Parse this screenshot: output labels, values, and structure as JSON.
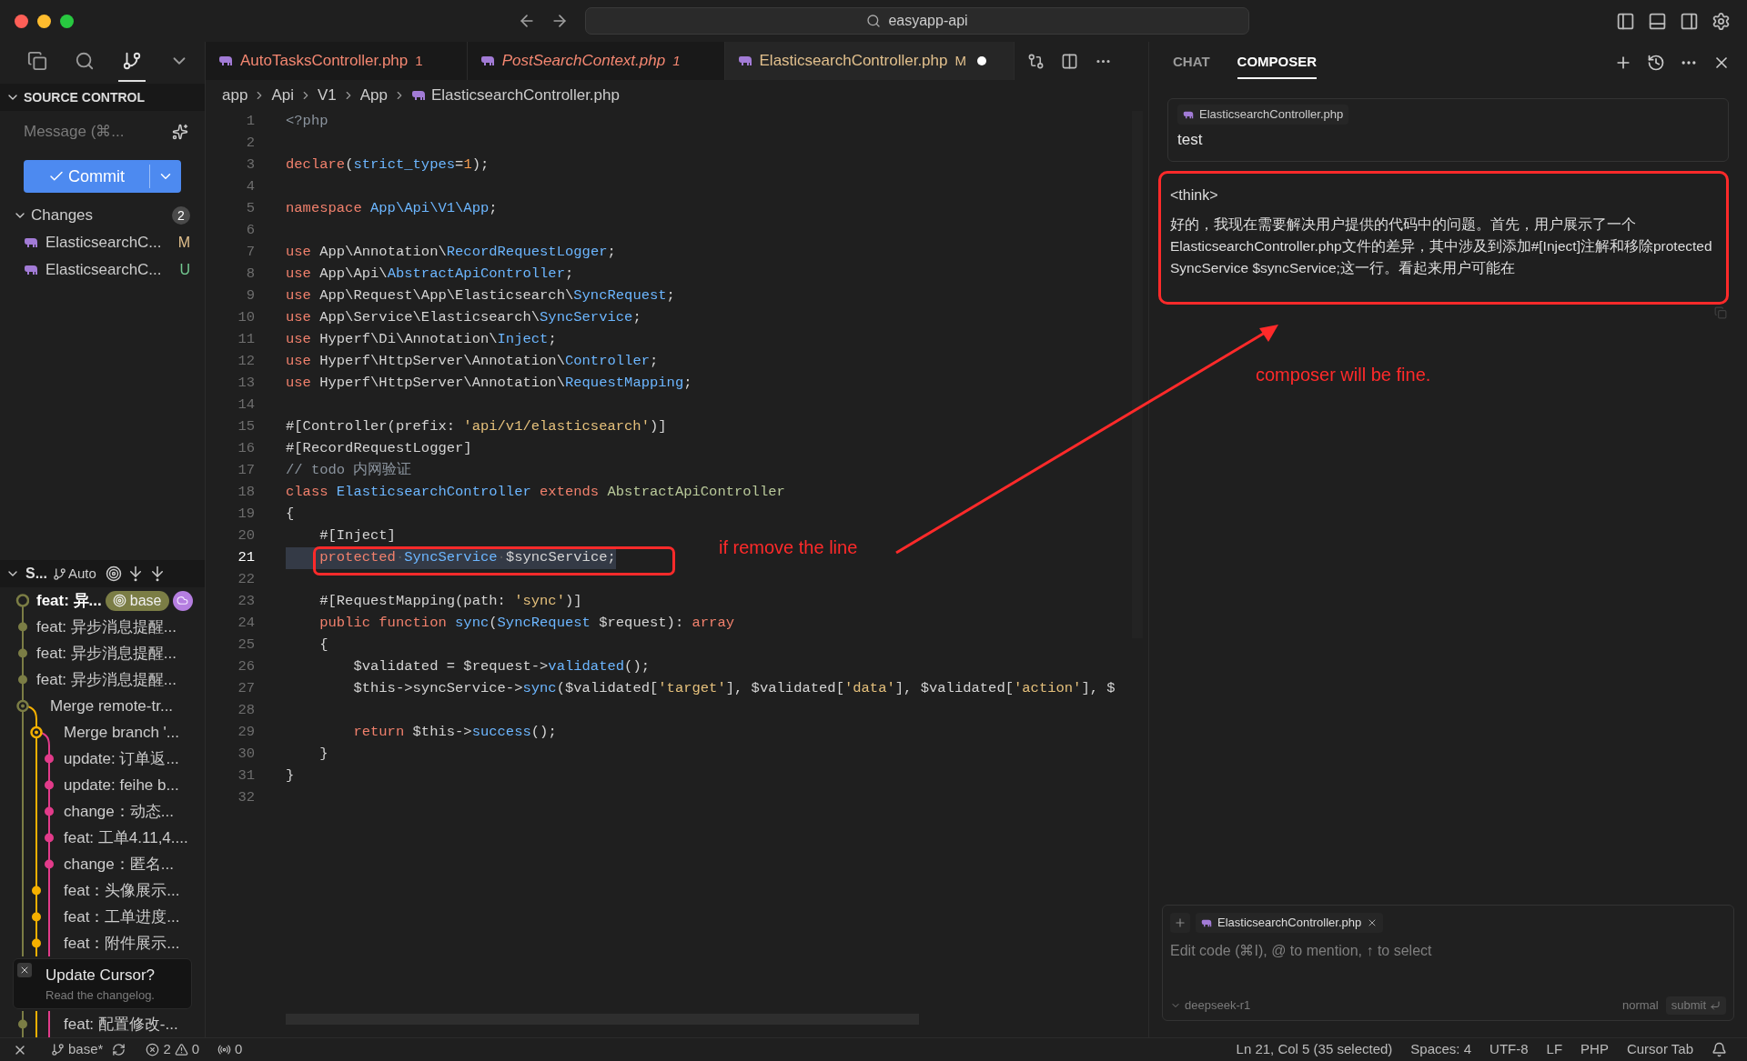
{
  "window": {
    "search": "easyapp-api"
  },
  "activity_bar": {
    "items": [
      {
        "kind": "files",
        "selected": false
      },
      {
        "kind": "search",
        "selected": false
      },
      {
        "kind": "source-control",
        "selected": true
      },
      {
        "kind": "more",
        "selected": false
      }
    ]
  },
  "source_control": {
    "title": "SOURCE CONTROL",
    "message": {
      "placeholder": "Message (⌘..."
    },
    "commit": {
      "label": "Commit"
    },
    "changes": {
      "title": "Changes",
      "count": "2",
      "expanded": true,
      "files": [
        {
          "name": "ElasticsearchC...",
          "status": "M",
          "kind": "modified"
        },
        {
          "name": "ElasticsearchC...",
          "status": "U",
          "kind": "untracked"
        }
      ]
    }
  },
  "graph": {
    "title": "S...",
    "mode": "Auto",
    "commits": [
      {
        "message": "feat: 异...",
        "kind": "head",
        "color": "#7b7d45",
        "badge": "base"
      },
      {
        "message": "feat: 异步消息提醒...",
        "kind": "main",
        "color": "#7b7d45"
      },
      {
        "message": "feat: 异步消息提醒...",
        "kind": "main",
        "color": "#7b7d45"
      },
      {
        "message": "feat: 异步消息提醒...",
        "kind": "main",
        "color": "#7b7d45"
      },
      {
        "message": "Merge remote-tr...",
        "kind": "merge",
        "color": "#7b7d45"
      },
      {
        "message": "Merge branch '...",
        "kind": "branch-merge",
        "color": "#f5b000"
      },
      {
        "message": "update: 订单返...",
        "kind": "feature",
        "color": "#e23b8a"
      },
      {
        "message": "update: feihe b...",
        "kind": "feature",
        "color": "#e23b8a"
      },
      {
        "message": "change：动态...",
        "kind": "feature",
        "color": "#e23b8a"
      },
      {
        "message": "feat: 工单4.11,4....",
        "kind": "feature",
        "color": "#e23b8a"
      },
      {
        "message": "change：匿名...",
        "kind": "feature",
        "color": "#e23b8a"
      },
      {
        "message": "feat：头像展示...",
        "kind": "branch",
        "color": "#f5b000"
      },
      {
        "message": "feat：工单进度...",
        "kind": "branch",
        "color": "#f5b000"
      },
      {
        "message": "feat：附件展示...",
        "kind": "branch",
        "color": "#f5b000"
      },
      {
        "message": "feat: 配置修改-...",
        "kind": "main",
        "color": "#7b7d45"
      }
    ]
  },
  "toast": {
    "title": "Update Cursor?",
    "body": "Read the changelog."
  },
  "editor": {
    "tabs": [
      {
        "name": "AutoTasksController.php",
        "badge": "1",
        "kind": "error",
        "preview": false,
        "dirty": false,
        "selected": false
      },
      {
        "name": "PostSearchContext.php",
        "badge": "1",
        "kind": "error",
        "preview": true,
        "dirty": false,
        "selected": false
      },
      {
        "name": "ElasticsearchController.php",
        "badge": "M",
        "kind": "modified",
        "preview": false,
        "dirty": true,
        "selected": true
      }
    ],
    "breadcrumb": [
      "app",
      "Api",
      "V1",
      "App",
      "ElasticsearchController.php"
    ],
    "lines": [
      {
        "number": "1",
        "current": false,
        "tokens": [
          {
            "kind": "comment",
            "text": "<?php"
          }
        ]
      },
      {
        "number": "2",
        "current": false
      },
      {
        "number": "3",
        "current": false,
        "tokens": [
          {
            "kind": "kw",
            "text": "declare"
          },
          {
            "kind": "plain",
            "text": "("
          },
          {
            "kind": "type",
            "text": "strict_types"
          },
          {
            "kind": "plain",
            "text": "="
          },
          {
            "kind": "num",
            "text": "1"
          },
          {
            "kind": "plain",
            "text": ");"
          }
        ]
      },
      {
        "number": "4",
        "current": false
      },
      {
        "number": "5",
        "current": false,
        "tokens": [
          {
            "kind": "kw",
            "text": "namespace "
          },
          {
            "kind": "type",
            "text": "App\\Api\\V1\\App"
          },
          {
            "kind": "plain",
            "text": ";"
          }
        ]
      },
      {
        "number": "6",
        "current": false
      },
      {
        "number": "7",
        "current": false,
        "tokens": [
          {
            "kind": "kw",
            "text": "use "
          },
          {
            "kind": "plain",
            "text": "App\\Annotation\\"
          },
          {
            "kind": "type",
            "text": "RecordRequestLogger"
          },
          {
            "kind": "plain",
            "text": ";"
          }
        ]
      },
      {
        "number": "8",
        "current": false,
        "tokens": [
          {
            "kind": "kw",
            "text": "use "
          },
          {
            "kind": "plain",
            "text": "App\\Api\\"
          },
          {
            "kind": "type",
            "text": "AbstractApiController"
          },
          {
            "kind": "plain",
            "text": ";"
          }
        ]
      },
      {
        "number": "9",
        "current": false,
        "tokens": [
          {
            "kind": "kw",
            "text": "use "
          },
          {
            "kind": "plain",
            "text": "App\\Request\\App\\Elasticsearch\\"
          },
          {
            "kind": "type",
            "text": "SyncRequest"
          },
          {
            "kind": "plain",
            "text": ";"
          }
        ]
      },
      {
        "number": "10",
        "current": false,
        "tokens": [
          {
            "kind": "kw",
            "text": "use "
          },
          {
            "kind": "plain",
            "text": "App\\Service\\Elasticsearch\\"
          },
          {
            "kind": "type",
            "text": "SyncService"
          },
          {
            "kind": "plain",
            "text": ";"
          }
        ]
      },
      {
        "number": "11",
        "current": false,
        "tokens": [
          {
            "kind": "kw",
            "text": "use "
          },
          {
            "kind": "plain",
            "text": "Hyperf\\Di\\Annotation\\"
          },
          {
            "kind": "type",
            "text": "Inject"
          },
          {
            "kind": "plain",
            "text": ";"
          }
        ]
      },
      {
        "number": "12",
        "current": false,
        "tokens": [
          {
            "kind": "kw",
            "text": "use "
          },
          {
            "kind": "plain",
            "text": "Hyperf\\HttpServer\\Annotation\\"
          },
          {
            "kind": "type",
            "text": "Controller"
          },
          {
            "kind": "plain",
            "text": ";"
          }
        ]
      },
      {
        "number": "13",
        "current": false,
        "tokens": [
          {
            "kind": "kw",
            "text": "use "
          },
          {
            "kind": "plain",
            "text": "Hyperf\\HttpServer\\Annotation\\"
          },
          {
            "kind": "type",
            "text": "RequestMapping"
          },
          {
            "kind": "plain",
            "text": ";"
          }
        ]
      },
      {
        "number": "14",
        "current": false
      },
      {
        "number": "15",
        "current": false,
        "tokens": [
          {
            "kind": "plain",
            "text": "#[Controller(prefix: "
          },
          {
            "kind": "str",
            "text": "'api/v1/elasticsearch'"
          },
          {
            "kind": "plain",
            "text": ")]"
          }
        ]
      },
      {
        "number": "16",
        "current": false,
        "tokens": [
          {
            "kind": "plain",
            "text": "#[RecordRequestLogger]"
          }
        ]
      },
      {
        "number": "17",
        "current": false,
        "tokens": [
          {
            "kind": "comment",
            "text": "// todo 内网验证"
          }
        ]
      },
      {
        "number": "18",
        "current": false,
        "tokens": [
          {
            "kind": "kw",
            "text": "class "
          },
          {
            "kind": "type",
            "text": "ElasticsearchController "
          },
          {
            "kind": "kw",
            "text": "extends "
          },
          {
            "kind": "class",
            "text": "AbstractApiController"
          }
        ]
      },
      {
        "number": "19",
        "current": false,
        "tokens": [
          {
            "kind": "plain",
            "text": "{"
          }
        ]
      },
      {
        "number": "20",
        "current": false,
        "tokens": [
          {
            "kind": "plain",
            "text": "    #[Inject]"
          }
        ]
      },
      {
        "number": "21",
        "current": true,
        "tokens": [
          {
            "kind": "kw",
            "text": "    protected"
          },
          {
            "kind": "ws",
            "text": "·"
          },
          {
            "kind": "type",
            "text": "SyncService"
          },
          {
            "kind": "ws",
            "text": "·"
          },
          {
            "kind": "plain",
            "text": "$syncService;"
          }
        ]
      },
      {
        "number": "22",
        "current": false
      },
      {
        "number": "23",
        "current": false,
        "tokens": [
          {
            "kind": "plain",
            "text": "    #[RequestMapping(path: "
          },
          {
            "kind": "str",
            "text": "'sync'"
          },
          {
            "kind": "plain",
            "text": ")]"
          }
        ]
      },
      {
        "number": "24",
        "current": false,
        "tokens": [
          {
            "kind": "kw",
            "text": "    public function "
          },
          {
            "kind": "fn",
            "text": "sync"
          },
          {
            "kind": "plain",
            "text": "("
          },
          {
            "kind": "type",
            "text": "SyncRequest "
          },
          {
            "kind": "plain",
            "text": "$request): "
          },
          {
            "kind": "kw",
            "text": "array"
          }
        ]
      },
      {
        "number": "25",
        "current": false,
        "tokens": [
          {
            "kind": "plain",
            "text": "    {"
          }
        ]
      },
      {
        "number": "26",
        "current": false,
        "tokens": [
          {
            "kind": "plain",
            "text": "        $validated = $request->"
          },
          {
            "kind": "fn",
            "text": "validated"
          },
          {
            "kind": "plain",
            "text": "();"
          }
        ]
      },
      {
        "number": "27",
        "current": false,
        "tokens": [
          {
            "kind": "plain",
            "text": "        $this->syncService->"
          },
          {
            "kind": "fn",
            "text": "sync"
          },
          {
            "kind": "plain",
            "text": "($validated["
          },
          {
            "kind": "str",
            "text": "'target'"
          },
          {
            "kind": "plain",
            "text": "], $validated["
          },
          {
            "kind": "str",
            "text": "'data'"
          },
          {
            "kind": "plain",
            "text": "], $validated["
          },
          {
            "kind": "str",
            "text": "'action'"
          },
          {
            "kind": "plain",
            "text": "], $"
          }
        ]
      },
      {
        "number": "28",
        "current": false
      },
      {
        "number": "29",
        "current": false,
        "tokens": [
          {
            "kind": "kw",
            "text": "        return "
          },
          {
            "kind": "plain",
            "text": "$this->"
          },
          {
            "kind": "fn",
            "text": "success"
          },
          {
            "kind": "plain",
            "text": "();"
          }
        ]
      },
      {
        "number": "30",
        "current": false,
        "tokens": [
          {
            "kind": "plain",
            "text": "    }"
          }
        ]
      },
      {
        "number": "31",
        "current": false,
        "tokens": [
          {
            "kind": "plain",
            "text": "}"
          }
        ]
      },
      {
        "number": "32",
        "current": false
      }
    ]
  },
  "composer": {
    "tabs": [
      {
        "label": "CHAT",
        "selected": false
      },
      {
        "label": "COMPOSER",
        "selected": true
      }
    ],
    "context": {
      "file": "ElasticsearchController.php",
      "text": "test"
    },
    "reply": {
      "tag": "<think>",
      "text": "好的，我现在需要解决用户提供的代码中的问题。首先，用户展示了一个ElasticsearchController.php文件的差异，其中涉及到添加#[Inject]注解和移除protected SyncService $syncService;这一行。看起来用户可能在"
    },
    "input": {
      "file": "ElasticsearchController.php",
      "placeholder": "Edit code (⌘I), @ to mention, ↑ to select",
      "model": "deepseek-r1",
      "mode": "normal",
      "submit": "submit"
    }
  },
  "status_bar": {
    "branch": "base*",
    "errors": "2",
    "warnings": "0",
    "ports": "0",
    "right": [
      "Ln 21, Col 5 (35 selected)",
      "Spaces: 4",
      "UTF-8",
      "LF",
      "PHP",
      "Cursor Tab"
    ]
  },
  "annotations": {
    "line_note": "if remove the line",
    "reply_note": "composer will be fine."
  }
}
